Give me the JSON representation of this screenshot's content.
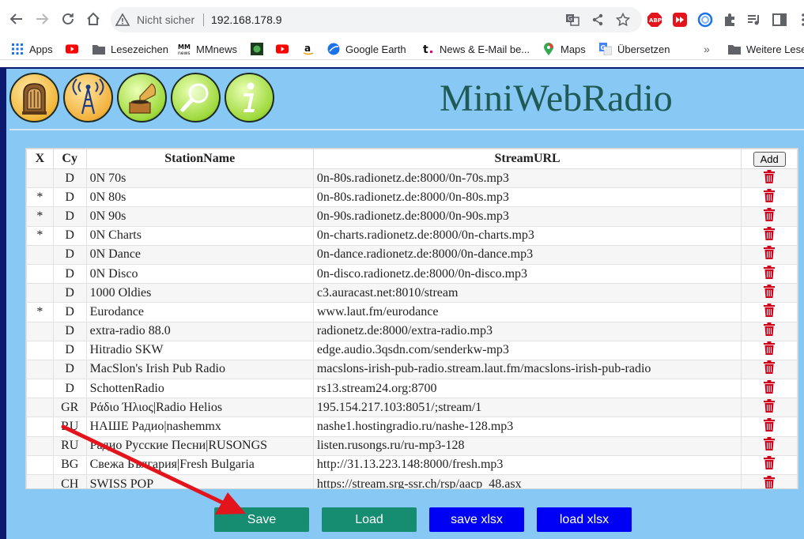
{
  "browser": {
    "insecure_label": "Nicht sicher",
    "url": "192.168.178.9",
    "bookmarks": [
      {
        "label": "Apps",
        "icon": "apps-grid-icon"
      },
      {
        "label": "",
        "icon": "youtube-icon"
      },
      {
        "label": "Lesezeichen",
        "icon": "folder-icon"
      },
      {
        "label": "MMnews",
        "icon": "mmnews-icon"
      },
      {
        "label": "",
        "icon": "green-square-icon"
      },
      {
        "label": "",
        "icon": "youtube-icon"
      },
      {
        "label": "",
        "icon": "amazon-icon"
      },
      {
        "label": "Google Earth",
        "icon": "google-earth-icon"
      },
      {
        "label": "News & E-Mail be...",
        "icon": "t-online-icon"
      },
      {
        "label": "Maps",
        "icon": "maps-pin-icon"
      },
      {
        "label": "Übersetzen",
        "icon": "translate-icon"
      },
      {
        "label": "Weitere Lese",
        "icon": "folder-icon"
      }
    ]
  },
  "header": {
    "title": "MiniWebRadio"
  },
  "table": {
    "columns": [
      "X",
      "Cy",
      "StationName",
      "StreamURL"
    ],
    "add_label": "Add",
    "rows": [
      {
        "x": "",
        "cy": "D",
        "name": "0N 70s",
        "url": "0n-80s.radionetz.de:8000/0n-70s.mp3"
      },
      {
        "x": "*",
        "cy": "D",
        "name": "0N 80s",
        "url": "0n-80s.radionetz.de:8000/0n-80s.mp3"
      },
      {
        "x": "*",
        "cy": "D",
        "name": "0N 90s",
        "url": "0n-90s.radionetz.de:8000/0n-90s.mp3"
      },
      {
        "x": "*",
        "cy": "D",
        "name": "0N Charts",
        "url": "0n-charts.radionetz.de:8000/0n-charts.mp3"
      },
      {
        "x": "",
        "cy": "D",
        "name": "0N Dance",
        "url": "0n-dance.radionetz.de:8000/0n-dance.mp3"
      },
      {
        "x": "",
        "cy": "D",
        "name": "0N Disco",
        "url": "0n-disco.radionetz.de:8000/0n-disco.mp3"
      },
      {
        "x": "",
        "cy": "D",
        "name": "1000 Oldies",
        "url": "c3.auracast.net:8010/stream"
      },
      {
        "x": "*",
        "cy": "D",
        "name": "Eurodance",
        "url": "www.laut.fm/eurodance"
      },
      {
        "x": "",
        "cy": "D",
        "name": "extra-radio 88.0",
        "url": "radionetz.de:8000/extra-radio.mp3"
      },
      {
        "x": "",
        "cy": "D",
        "name": "Hitradio SKW",
        "url": "edge.audio.3qsdn.com/senderkw-mp3"
      },
      {
        "x": "",
        "cy": "D",
        "name": "MacSlon's Irish Pub Radio",
        "url": "macslons-irish-pub-radio.stream.laut.fm/macslons-irish-pub-radio"
      },
      {
        "x": "",
        "cy": "D",
        "name": "SchottenRadio",
        "url": "rs13.stream24.org:8700"
      },
      {
        "x": "",
        "cy": "GR",
        "name": "Ράδιο Ήλιος|Radio Helios",
        "url": "195.154.217.103:8051/;stream/1"
      },
      {
        "x": "",
        "cy": "RU",
        "name": "НАШЕ Радио|nashemmx",
        "url": "nashe1.hostingradio.ru/nashe-128.mp3"
      },
      {
        "x": "",
        "cy": "RU",
        "name": "Радио Русские Песни|RUSONGS",
        "url": "listen.rusongs.ru/ru-mp3-128"
      },
      {
        "x": "",
        "cy": "BG",
        "name": "Свежа България|Fresh Bulgaria",
        "url": "http://31.13.223.148:8000/fresh.mp3"
      },
      {
        "x": "",
        "cy": "CH",
        "name": "SWISS POP",
        "url": "https://stream.srg-ssr.ch/rsp/aacp_48.asx"
      }
    ]
  },
  "buttons": {
    "save": "Save",
    "load": "Load",
    "save_xlsx": "save xlsx",
    "load_xlsx": "load xlsx"
  },
  "colors": {
    "page_background": "#0b1a6e",
    "panel_background": "#87c8f4",
    "title": "#1f5a55",
    "green_button": "#168c70",
    "blue_button": "#0000f5",
    "delete_icon": "#d0021b",
    "annotation_arrow": "#e3141b"
  }
}
